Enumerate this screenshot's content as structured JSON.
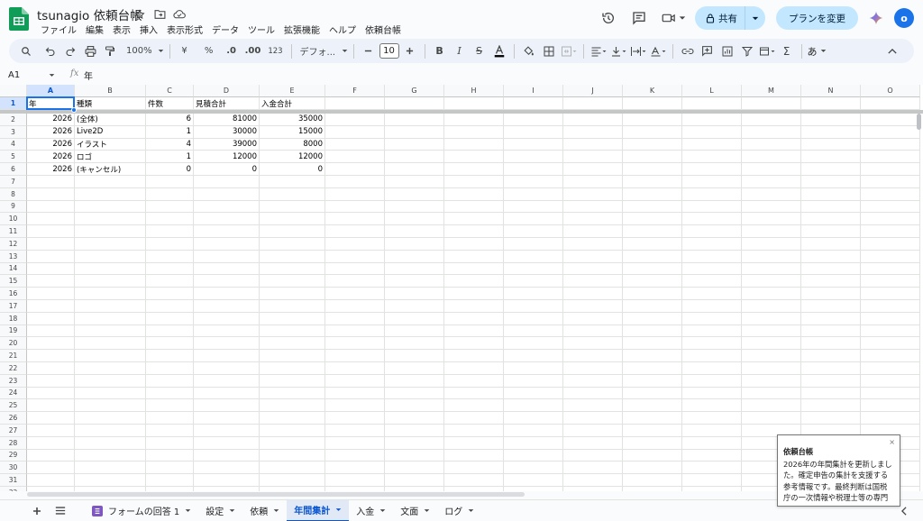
{
  "header": {
    "title": "tsunagio 依頼台帳",
    "menu": [
      "ファイル",
      "編集",
      "表示",
      "挿入",
      "表示形式",
      "データ",
      "ツール",
      "拡張機能",
      "ヘルプ",
      "依頼台帳"
    ],
    "share_label": "共有",
    "plan_label": "プランを変更",
    "avatar_letter": "o"
  },
  "toolbar": {
    "zoom": "100%",
    "currency": "¥",
    "percent": "%",
    "dec_decrease": ".0",
    "dec_increase": ".00",
    "number_format": "123",
    "font": "デフォ...",
    "font_size": "10",
    "input_tool": "あ"
  },
  "formula_bar": {
    "cell_ref": "A1",
    "fx": "fx",
    "value": "年"
  },
  "grid": {
    "columns": [
      "A",
      "B",
      "C",
      "D",
      "E",
      "F",
      "G",
      "H",
      "I",
      "J",
      "K",
      "L",
      "M",
      "N",
      "O"
    ],
    "rows": [
      [
        "年",
        "種類",
        "件数",
        "見積合計",
        "入金合計"
      ],
      [
        "2026",
        "(全体)",
        "6",
        "81000",
        "35000"
      ],
      [
        "2026",
        "Live2D",
        "1",
        "30000",
        "15000"
      ],
      [
        "2026",
        "イラスト",
        "4",
        "39000",
        "8000"
      ],
      [
        "2026",
        "ロゴ",
        "1",
        "12000",
        "12000"
      ],
      [
        "2026",
        "(キャンセル)",
        "0",
        "0",
        "0"
      ]
    ],
    "row_numbers": [
      "1",
      "2",
      "3",
      "4",
      "5",
      "6",
      "7",
      "8",
      "9",
      "10",
      "11",
      "12",
      "13",
      "14",
      "15",
      "16",
      "17",
      "18",
      "19",
      "20",
      "21",
      "22",
      "23",
      "24",
      "25",
      "26",
      "27",
      "28",
      "29",
      "30",
      "31",
      "32"
    ]
  },
  "sheets": [
    {
      "label": "フォームの回答 1",
      "active": false,
      "icon": "form-icon"
    },
    {
      "label": "設定",
      "active": false
    },
    {
      "label": "依頼",
      "active": false
    },
    {
      "label": "年間集計",
      "active": true
    },
    {
      "label": "入金",
      "active": false
    },
    {
      "label": "文面",
      "active": false
    },
    {
      "label": "ログ",
      "active": false
    }
  ],
  "notification": {
    "title": "依頼台帳",
    "body": "2026年の年間集計を更新しました。確定申告の集計を支援する参考情報です。最終判断は国税庁の一次情報や税理士等の専門",
    "close": "×"
  },
  "colors": {
    "accent": "#1a73e8",
    "share_bg": "#c2e7ff",
    "sheets_green": "#0f9d58"
  }
}
